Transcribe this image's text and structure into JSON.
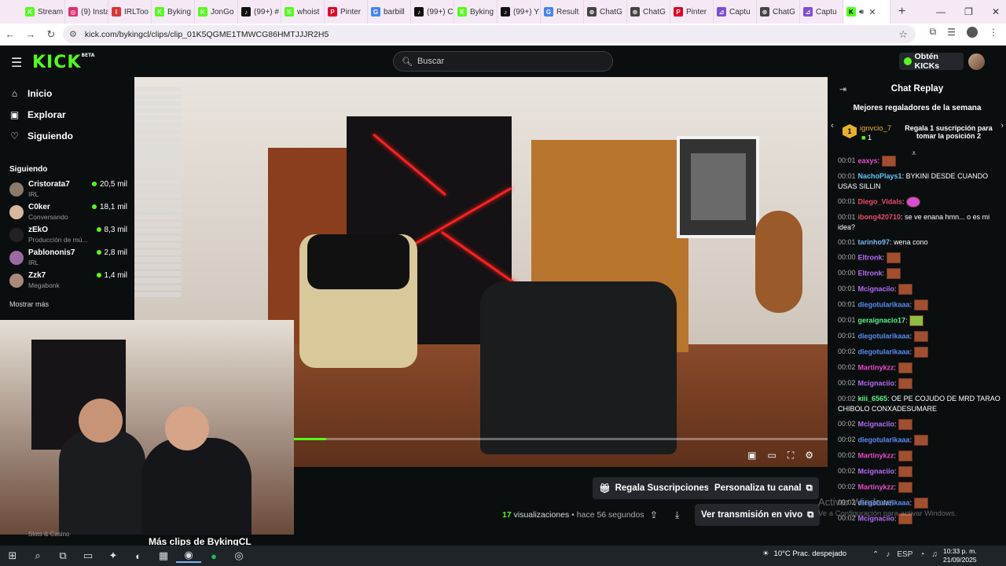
{
  "browser": {
    "tabs": [
      {
        "label": "Stream",
        "color": "#53fc18",
        "fav": "K"
      },
      {
        "label": "(9) Insta",
        "color": "#e1306c",
        "fav": "◎"
      },
      {
        "label": "IRLToo",
        "color": "#d33",
        "fav": "I"
      },
      {
        "label": "Byking",
        "color": "#53fc18",
        "fav": "K"
      },
      {
        "label": "JonGo",
        "color": "#53fc18",
        "fav": "K"
      },
      {
        "label": "(99+) #",
        "color": "#111",
        "fav": "♪"
      },
      {
        "label": "whoist",
        "color": "#53fc18",
        "fav": "K"
      },
      {
        "label": "Pinter",
        "color": "#e60023",
        "fav": "P"
      },
      {
        "label": "barbill",
        "color": "#4285f4",
        "fav": "G"
      },
      {
        "label": "(99+) C",
        "color": "#111",
        "fav": "♪"
      },
      {
        "label": "Byking",
        "color": "#53fc18",
        "fav": "K"
      },
      {
        "label": "(99+) Y",
        "color": "#111",
        "fav": "♪"
      },
      {
        "label": "Result",
        "color": "#4285f4",
        "fav": "G"
      },
      {
        "label": "ChatG",
        "color": "#444",
        "fav": "⊛"
      },
      {
        "label": "ChatG",
        "color": "#444",
        "fav": "⊛"
      },
      {
        "label": "Pinter",
        "color": "#e60023",
        "fav": "P"
      },
      {
        "label": "Captu",
        "color": "#7b4fd4",
        "fav": "⊿"
      },
      {
        "label": "ChatG",
        "color": "#444",
        "fav": "⊛"
      },
      {
        "label": "Captu",
        "color": "#7b4fd4",
        "fav": "⊿"
      }
    ],
    "url": "kick.com/bykingcl/clips/clip_01K5QGME1TMWCG86HMTJJJR2H5"
  },
  "header": {
    "logo": "KICK",
    "logo_beta": "BETA",
    "search_placeholder": "Buscar",
    "cta": "Obtén KICKs"
  },
  "sidebar": {
    "nav": [
      {
        "label": "Inicio",
        "icon": "home-icon",
        "glyph": "⌂"
      },
      {
        "label": "Explorar",
        "icon": "explore-icon",
        "glyph": "▣"
      },
      {
        "label": "Siguiendo",
        "icon": "heart-icon",
        "glyph": "♡"
      }
    ],
    "following_title": "Siguiendo",
    "following": [
      {
        "name": "Cristorata7",
        "category": "IRL",
        "viewers": "20,5 mil",
        "avatar": "#8a7a6a"
      },
      {
        "name": "C0ker",
        "category": "Conversando",
        "viewers": "18,1 mil",
        "avatar": "#d8b8a0"
      },
      {
        "name": "zEkO",
        "category": "Producción de mú...",
        "viewers": "8,3 mil",
        "avatar": "#222"
      },
      {
        "name": "Pablononis7",
        "category": "IRL",
        "viewers": "2,8 mil",
        "avatar": "#9a6aa0"
      },
      {
        "name": "Zzk7",
        "category": "Megabonk",
        "viewers": "1,4 mil",
        "avatar": "#aa8a7a"
      }
    ],
    "show_more": "Mostrar más",
    "bottom_label": "Slots & Casino"
  },
  "video": {
    "progress": 0.06
  },
  "actions": {
    "gift": "Regala Suscripciones",
    "customize": "Personaliza tu canal",
    "live": "Ver transmisión en vivo",
    "views_count": "17",
    "views_label": "visualizaciones",
    "separator": "•",
    "time_ago": "hace 56 segundos",
    "more_clips": "Más clips de BykingCL"
  },
  "chat": {
    "title": "Chat Replay",
    "gifters_title": "Mejores regaladores de la semana",
    "top_gifter": {
      "rank": "1",
      "name": "ignvcio_7",
      "count": "1"
    },
    "gift_cta": "Regala 1 suscripción para tomar la posición 2",
    "messages": [
      {
        "time": "00:01",
        "user": "eaxys",
        "color": "#e64cc8",
        "text": "",
        "emote": "brown"
      },
      {
        "time": "00:01",
        "user": "NachoPlays1",
        "color": "#5ac8fa",
        "text": "BYKINI DESDE CUANDO USAS SILLIN",
        "emote": ""
      },
      {
        "time": "00:01",
        "user": "Diego_Vidals",
        "color": "#e64c6c",
        "text": "",
        "emote": "purple"
      },
      {
        "time": "00:01",
        "user": "ibong420710",
        "color": "#e64c6c",
        "text": "se ve enana hmn... o es mi idea?",
        "emote": ""
      },
      {
        "time": "00:01",
        "user": "tarinho97",
        "color": "#7ab4f5",
        "text": "wena cono",
        "emote": ""
      },
      {
        "time": "00:00",
        "user": "Eltronk",
        "color": "#b46cf5",
        "text": "",
        "emote": "brown"
      },
      {
        "time": "00:00",
        "user": "Eltronk",
        "color": "#b46cf5",
        "text": "",
        "emote": "brown"
      },
      {
        "time": "00:01",
        "user": "Mcignaciio",
        "color": "#b46cf5",
        "text": "",
        "emote": "brown"
      },
      {
        "time": "00:01",
        "user": "diegotularikaaa",
        "color": "#5a8cf5",
        "text": "",
        "emote": "brown"
      },
      {
        "time": "00:01",
        "user": "geraignacio17",
        "color": "#5af588",
        "text": "",
        "emote": "green"
      },
      {
        "time": "00:01",
        "user": "diegotularikaaa",
        "color": "#5a8cf5",
        "text": "",
        "emote": "brown"
      },
      {
        "time": "00:02",
        "user": "diegotularikaaa",
        "color": "#5a8cf5",
        "text": "",
        "emote": "brown"
      },
      {
        "time": "00:02",
        "user": "Martinykzz",
        "color": "#e64cc8",
        "text": "",
        "emote": "brown"
      },
      {
        "time": "00:02",
        "user": "Mcignaciio",
        "color": "#b46cf5",
        "text": "",
        "emote": "brown"
      },
      {
        "time": "00:02",
        "user": "kiii_6565",
        "color": "#5af588",
        "text": "OE PE COJUDO DE MRD TARAO CHIBOLO CONXADESUMARE",
        "emote": ""
      },
      {
        "time": "00:02",
        "user": "Mcignaciio",
        "color": "#b46cf5",
        "text": "",
        "emote": "brown"
      },
      {
        "time": "00:02",
        "user": "diegotularikaaa",
        "color": "#5a8cf5",
        "text": "",
        "emote": "brown"
      },
      {
        "time": "00:02",
        "user": "Martinykzz",
        "color": "#e64cc8",
        "text": "",
        "emote": "brown"
      },
      {
        "time": "00:02",
        "user": "Mcignaciio",
        "color": "#b46cf5",
        "text": "",
        "emote": "brown"
      },
      {
        "time": "00:02",
        "user": "Martinykzz",
        "color": "#e64cc8",
        "text": "",
        "emote": "brown"
      },
      {
        "time": "00:02",
        "user": "diegotularikaaa",
        "color": "#5a8cf5",
        "text": "",
        "emote": "brown"
      },
      {
        "time": "00:02",
        "user": "Mcignaciio",
        "color": "#b46cf5",
        "text": "",
        "emote": "brown"
      }
    ]
  },
  "watermark": {
    "line1": "Activar Windows",
    "line2": "Ve a Configuración para activar Windows."
  },
  "taskbar": {
    "weather": "10°C  Prac. despejado",
    "lang": "ESP",
    "time": "10:33 p. m.",
    "date": "21/09/2025"
  }
}
